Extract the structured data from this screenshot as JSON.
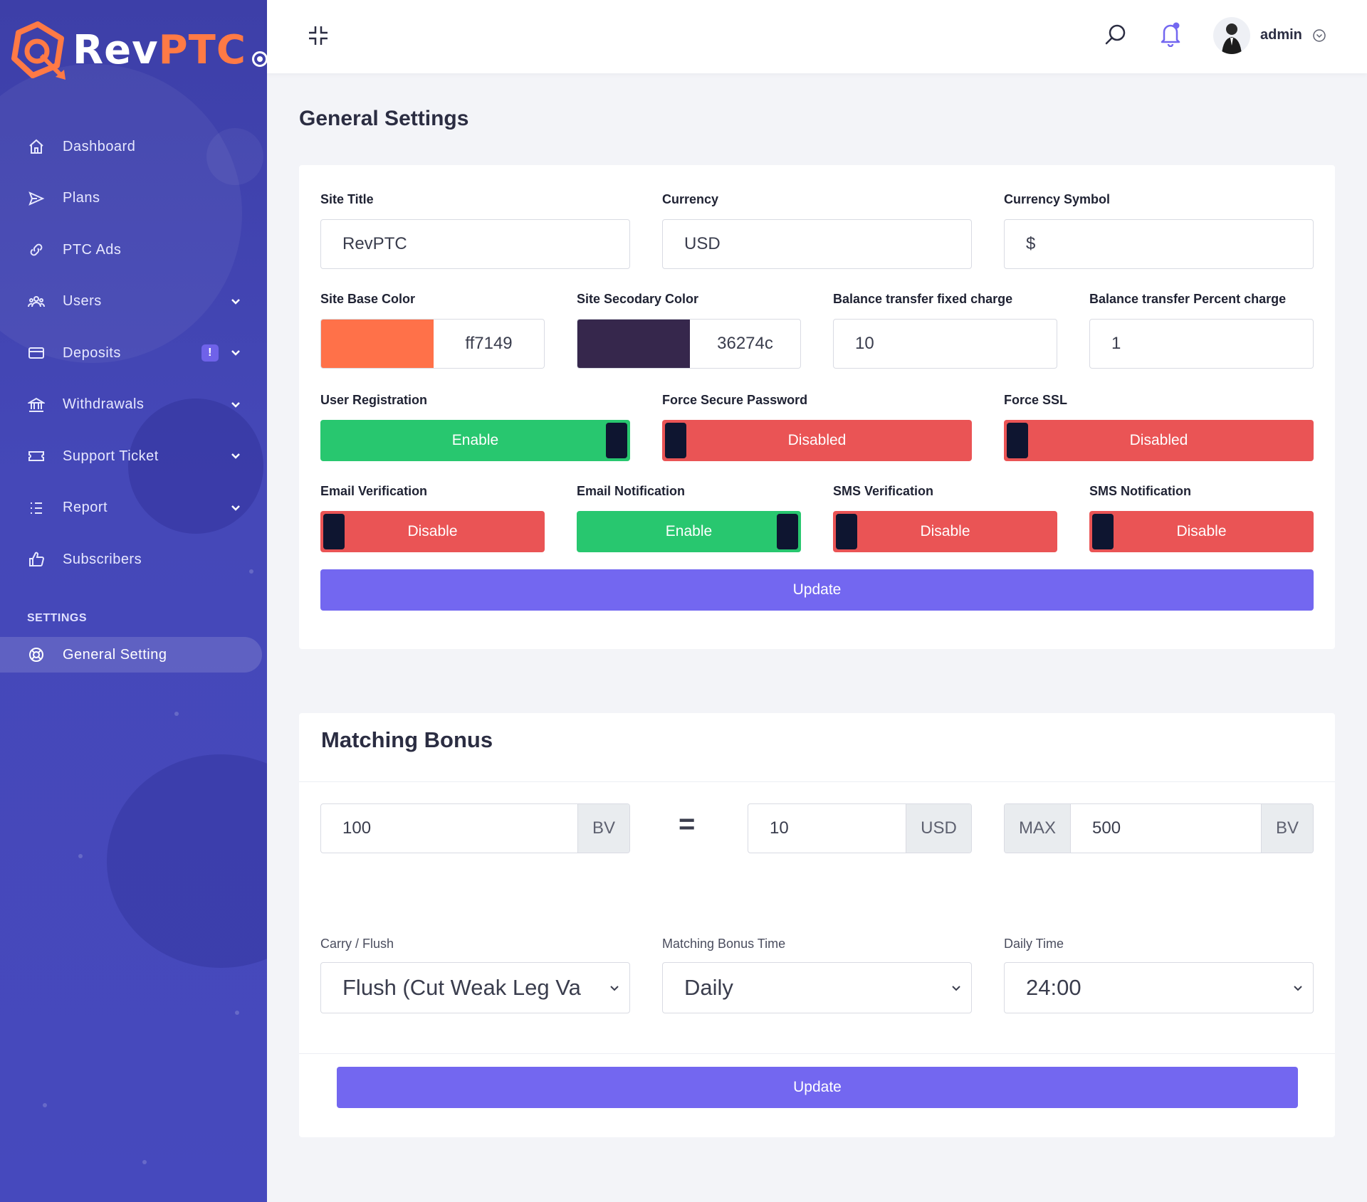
{
  "brand": {
    "part1": "Rev",
    "part2": "PTC"
  },
  "sidebar": {
    "items": [
      {
        "label": "Dashboard"
      },
      {
        "label": "Plans"
      },
      {
        "label": "PTC Ads"
      },
      {
        "label": "Users"
      },
      {
        "label": "Deposits",
        "badge": "!"
      },
      {
        "label": "Withdrawals"
      },
      {
        "label": "Support Ticket"
      },
      {
        "label": "Report"
      },
      {
        "label": "Subscribers"
      }
    ],
    "section_label": "SETTINGS",
    "active_item": "General Setting"
  },
  "header": {
    "user_name": "admin"
  },
  "page": {
    "title": "General Settings"
  },
  "general": {
    "site_title": {
      "label": "Site Title",
      "value": "RevPTC"
    },
    "currency": {
      "label": "Currency",
      "value": "USD"
    },
    "currency_symbol": {
      "label": "Currency Symbol",
      "value": "$"
    },
    "base_color": {
      "label": "Site Base Color",
      "value": "ff7149",
      "color": "#ff7149"
    },
    "secondary_color": {
      "label": "Site Secodary Color",
      "value": "36274c",
      "color": "#36274c"
    },
    "fixed_charge": {
      "label": "Balance transfer fixed charge",
      "value": "10"
    },
    "percent_charge": {
      "label": "Balance transfer Percent charge",
      "value": "1"
    },
    "user_registration": {
      "label": "User Registration",
      "state": "Enable"
    },
    "force_secure_password": {
      "label": "Force Secure Password",
      "state": "Disabled"
    },
    "force_ssl": {
      "label": "Force SSL",
      "state": "Disabled"
    },
    "email_verification": {
      "label": "Email Verification",
      "state": "Disable"
    },
    "email_notification": {
      "label": "Email Notification",
      "state": "Enable"
    },
    "sms_verification": {
      "label": "SMS Verification",
      "state": "Disable"
    },
    "sms_notification": {
      "label": "SMS Notification",
      "state": "Disable"
    },
    "update_label": "Update"
  },
  "matching": {
    "title": "Matching Bonus",
    "bv_value": "100",
    "bv_unit": "BV",
    "equals": "=",
    "usd_value": "10",
    "usd_unit": "USD",
    "max_label": "MAX",
    "max_value": "500",
    "max_unit": "BV",
    "carry_flush": {
      "label": "Carry / Flush",
      "value": "Flush (Cut Weak Leg Va"
    },
    "bonus_time": {
      "label": "Matching Bonus Time",
      "value": "Daily"
    },
    "daily_time": {
      "label": "Daily Time",
      "value": "24:00"
    },
    "update_label": "Update"
  },
  "colors": {
    "sidebar": "#4347b4",
    "primary": "#7367f0",
    "success": "#28c76f",
    "danger": "#ea5455",
    "brand_orange": "#ff7a45"
  }
}
